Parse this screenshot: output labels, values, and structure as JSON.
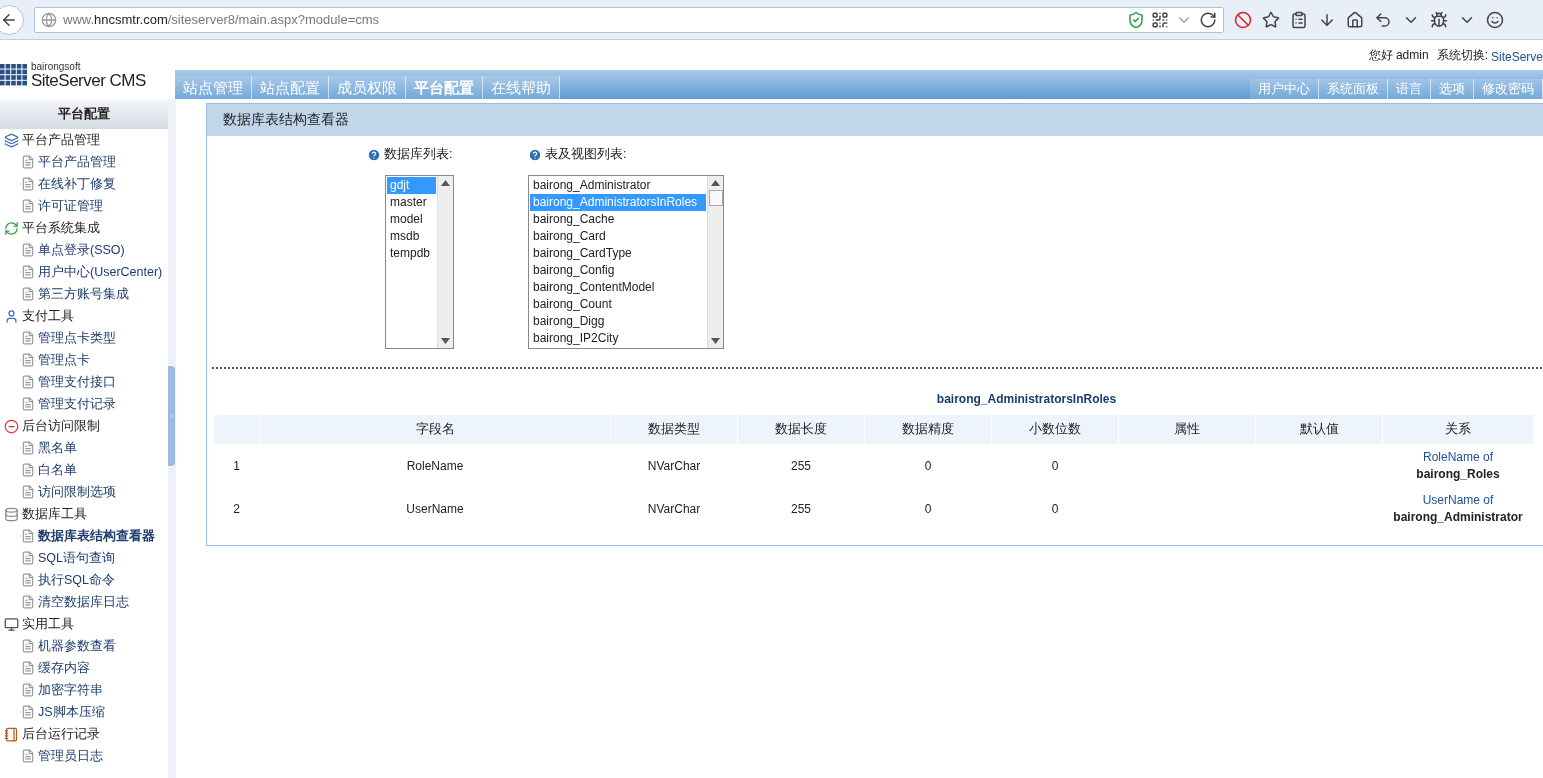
{
  "browser": {
    "url_host": "www.hncsmtr.com",
    "url_path": "/siteserver8/main.aspx?module=cms"
  },
  "header": {
    "brand_small": "bairongsoft",
    "brand": "SiteServer CMS",
    "greeting": "您好 admin",
    "switch_label": "系统切换:",
    "switch_link": "SiteServe"
  },
  "nav_tabs": [
    {
      "label": "站点管理",
      "selected": false
    },
    {
      "label": "站点配置",
      "selected": false
    },
    {
      "label": "成员权限",
      "selected": false
    },
    {
      "label": "平台配置",
      "selected": true
    },
    {
      "label": "在线帮助",
      "selected": false
    }
  ],
  "nav_right": [
    "用户中心",
    "系统面板",
    "语言",
    "选项",
    "修改密码"
  ],
  "sidebar": {
    "title": "平台配置",
    "groups": [
      {
        "label": "平台产品管理",
        "kind": "windows",
        "children": [
          {
            "label": "平台产品管理",
            "selected": false
          },
          {
            "label": "在线补丁修复",
            "selected": false
          },
          {
            "label": "许可证管理",
            "selected": false
          }
        ]
      },
      {
        "label": "平台系统集成",
        "kind": "sync",
        "children": [
          {
            "label": "单点登录(SSO)",
            "selected": false
          },
          {
            "label": "用户中心(UserCenter)",
            "selected": false
          },
          {
            "label": "第三方账号集成",
            "selected": false
          }
        ]
      },
      {
        "label": "支付工具",
        "kind": "user",
        "children": [
          {
            "label": "管理点卡类型",
            "selected": false
          },
          {
            "label": "管理点卡",
            "selected": false
          },
          {
            "label": "管理支付接口",
            "selected": false
          },
          {
            "label": "管理支付记录",
            "selected": false
          }
        ]
      },
      {
        "label": "后台访问限制",
        "kind": "block",
        "children": [
          {
            "label": "黑名单",
            "selected": false
          },
          {
            "label": "白名单",
            "selected": false
          },
          {
            "label": "访问限制选项",
            "selected": false
          }
        ]
      },
      {
        "label": "数据库工具",
        "kind": "database",
        "children": [
          {
            "label": "数据库表结构查看器",
            "selected": true
          },
          {
            "label": "SQL语句查询",
            "selected": false
          },
          {
            "label": "执行SQL命令",
            "selected": false
          },
          {
            "label": "清空数据库日志",
            "selected": false
          }
        ]
      },
      {
        "label": "实用工具",
        "kind": "computer",
        "children": [
          {
            "label": "机器参数查看",
            "selected": false
          },
          {
            "label": "缓存内容",
            "selected": false
          },
          {
            "label": "加密字符串",
            "selected": false
          },
          {
            "label": "JS脚本压缩",
            "selected": false
          }
        ]
      },
      {
        "label": "后台运行记录",
        "kind": "notebook",
        "children": [
          {
            "label": "管理员日志",
            "selected": false
          }
        ]
      }
    ]
  },
  "panel": {
    "title": "数据库表结构查看器",
    "database_list": {
      "label": "数据库列表:",
      "items": [
        {
          "label": "gdjt",
          "selected": true
        },
        {
          "label": "master",
          "selected": false
        },
        {
          "label": "model",
          "selected": false
        },
        {
          "label": "msdb",
          "selected": false
        },
        {
          "label": "tempdb",
          "selected": false
        }
      ]
    },
    "table_list": {
      "label": "表及视图列表:",
      "items": [
        {
          "label": "bairong_Administrator",
          "selected": false
        },
        {
          "label": "bairong_AdministratorsInRoles",
          "selected": true
        },
        {
          "label": "bairong_Cache",
          "selected": false
        },
        {
          "label": "bairong_Card",
          "selected": false
        },
        {
          "label": "bairong_CardType",
          "selected": false
        },
        {
          "label": "bairong_Config",
          "selected": false
        },
        {
          "label": "bairong_ContentModel",
          "selected": false
        },
        {
          "label": "bairong_Count",
          "selected": false
        },
        {
          "label": "bairong_Digg",
          "selected": false
        },
        {
          "label": "bairong_IP2City",
          "selected": false
        }
      ]
    },
    "table": {
      "title": "bairong_AdministratorsInRoles",
      "columns": [
        "字段名",
        "数据类型",
        "数据长度",
        "数据精度",
        "小数位数",
        "属性",
        "默认值",
        "关系"
      ],
      "rows": [
        {
          "index": "1",
          "name": "RoleName",
          "type": "NVarChar",
          "length": "255",
          "precision": "0",
          "scale": "0",
          "relation_text": "RoleName of",
          "relation_table": "bairong_Roles"
        },
        {
          "index": "2",
          "name": "UserName",
          "type": "NVarChar",
          "length": "255",
          "precision": "0",
          "scale": "0",
          "relation_text": "UserName of",
          "relation_table": "bairong_Administrator"
        }
      ]
    }
  }
}
